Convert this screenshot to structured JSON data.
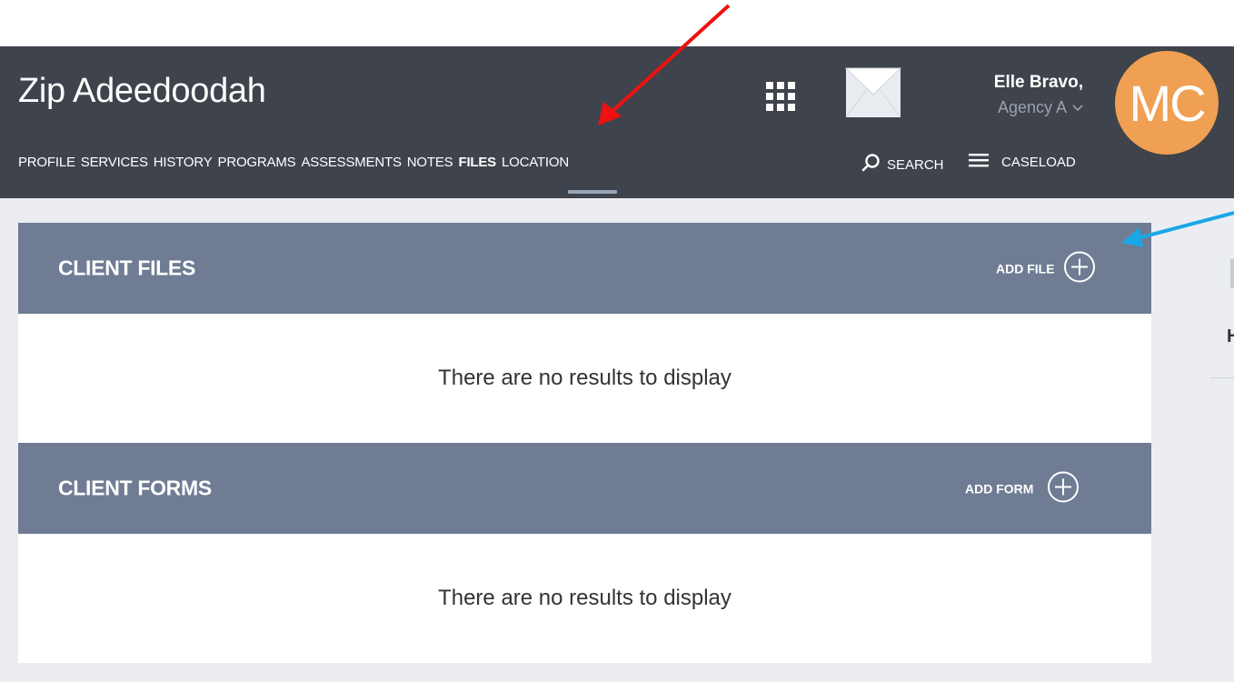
{
  "header": {
    "client_name": "Zip Adeedoodah",
    "user_name": "Elle Bravo,",
    "agency": "Agency A",
    "avatar_initials": "MC",
    "avatar_color": "#f0a052",
    "search_label": "SEARCH",
    "caseload_label": "CASELOAD"
  },
  "tabs": [
    {
      "label": "PROFILE",
      "active": false
    },
    {
      "label": "SERVICES",
      "active": false
    },
    {
      "label": "HISTORY",
      "active": false
    },
    {
      "label": "PROGRAMS",
      "active": false
    },
    {
      "label": "ASSESSMENTS",
      "active": false
    },
    {
      "label": "NOTES",
      "active": false
    },
    {
      "label": "FILES",
      "active": true
    },
    {
      "label": "LOCATION",
      "active": false
    }
  ],
  "sections": {
    "files": {
      "title": "CLIENT FILES",
      "add_label": "ADD FILE",
      "empty_message": "There are no results to display"
    },
    "forms": {
      "title": "CLIENT FORMS",
      "add_label": "ADD FORM",
      "empty_message": "There are no results to display"
    }
  },
  "right_panel": {
    "partial_text": "H"
  },
  "annotations": {
    "red_arrow_color": "#ee1111",
    "blue_arrow_color": "#1aa7e6"
  }
}
